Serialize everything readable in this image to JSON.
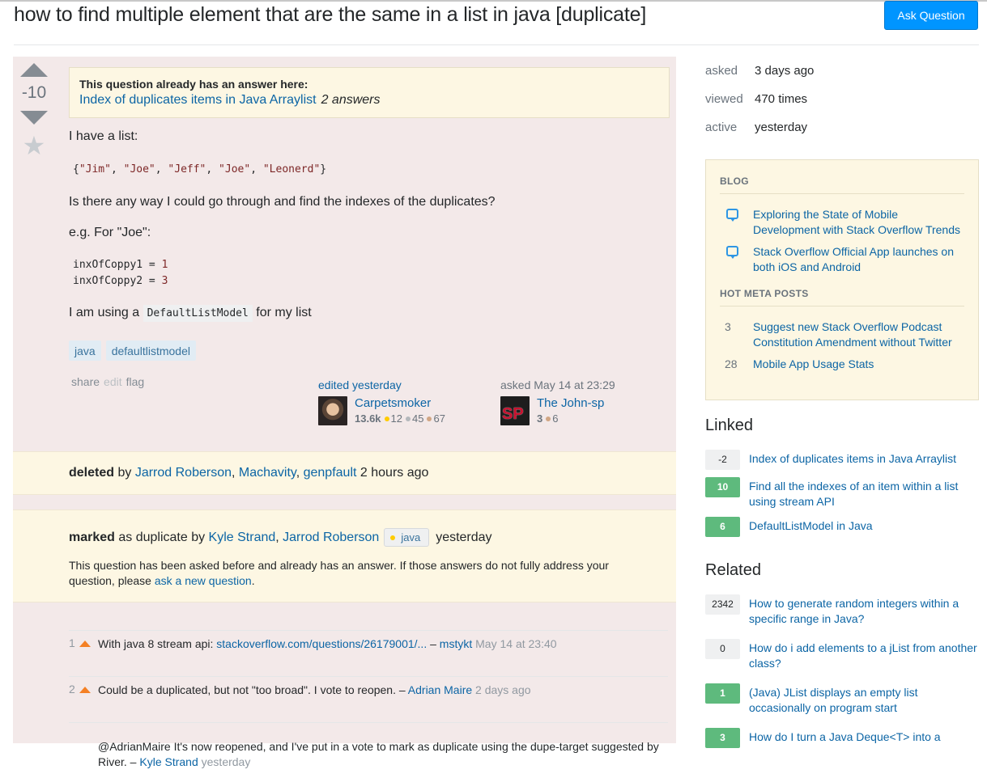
{
  "header": {
    "title": "how to find multiple element that are the same in a list in java [duplicate]",
    "ask_button": "Ask Question"
  },
  "question": {
    "vote_count": "-10",
    "duplicate_notice": {
      "lead": "This question already has an answer here:",
      "link": "Index of duplicates items in Java Arraylist",
      "answers": "2 answers"
    },
    "body": {
      "p1": "I have a list:",
      "code1": {
        "open": "{",
        "items": [
          "\"Jim\"",
          "\"Joe\"",
          "\"Jeff\"",
          "\"Joe\"",
          "\"Leonerd\""
        ],
        "close": "}"
      },
      "p2": "Is there any way I could go through and find the indexes of the duplicates?",
      "p3": "e.g. For \"Joe\":",
      "code2": [
        {
          "name": "inxOfCoppy1",
          "op": " = ",
          "value": "1"
        },
        {
          "name": "inxOfCoppy2",
          "op": " = ",
          "value": "3"
        }
      ],
      "p4_before": "I am using a ",
      "p4_code": "DefaultListModel",
      "p4_after": " for my list"
    },
    "tags": [
      "java",
      "defaultlistmodel"
    ],
    "menu": {
      "share": "share",
      "edit": "edit",
      "flag": "flag"
    },
    "editor": {
      "action": "edited yesterday",
      "name": "Carpetsmoker",
      "rep": "13.6k",
      "gold": "12",
      "silver": "45",
      "bronze": "67"
    },
    "owner": {
      "action": "asked May 14 at 23:29",
      "name": "The John-sp",
      "rep": "3",
      "bronze": "6"
    }
  },
  "deleted": {
    "label": "deleted",
    "by": " by ",
    "users": [
      "Jarrod Roberson",
      "Machavity",
      "genpfault"
    ],
    "time": " 2 hours ago"
  },
  "marked": {
    "label": "marked",
    "text": " as duplicate by ",
    "users": [
      "Kyle Strand",
      "Jarrod Roberson"
    ],
    "badge": "java",
    "time": "yesterday",
    "desc_before": "This question has been asked before and already has an answer. If those answers do not fully address your question, please ",
    "desc_link": "ask a new question",
    "desc_after": "."
  },
  "comments": [
    {
      "score": "1",
      "text": "With java 8 stream api: ",
      "link": "stackoverflow.com/questions/26179001/...",
      "user": "mstykt",
      "date": "May 14 at 23:40"
    },
    {
      "score": "2",
      "text": "Could be a duplicated, but not \"too broad\". I vote to reopen.",
      "user": "Adrian Maire",
      "date": "2 days ago"
    },
    {
      "score": "",
      "text": "@AdrianMaire It's now reopened, and I've put in a vote to mark as duplicate using the dupe-target suggested by River.",
      "user": "Kyle Strand",
      "date": "yesterday"
    }
  ],
  "sidebar": {
    "stats": [
      {
        "label": "asked",
        "value": "3 days ago"
      },
      {
        "label": "viewed",
        "value": "470 times"
      },
      {
        "label": "active",
        "value": "yesterday"
      }
    ],
    "blog": {
      "heading": "BLOG",
      "items": [
        "Exploring the State of Mobile Development with Stack Overflow Trends",
        "Stack Overflow Official App launches on both iOS and Android"
      ]
    },
    "hot_meta": {
      "heading": "HOT META POSTS",
      "items": [
        {
          "count": "3",
          "title": "Suggest new Stack Overflow Podcast Constitution Amendment without Twitter"
        },
        {
          "count": "28",
          "title": "Mobile App Usage Stats"
        }
      ]
    },
    "linked": {
      "heading": "Linked",
      "items": [
        {
          "score": "-2",
          "answered": false,
          "title": "Index of duplicates items in Java Arraylist"
        },
        {
          "score": "10",
          "answered": true,
          "title": "Find all the indexes of an item within a list using stream API"
        },
        {
          "score": "6",
          "answered": true,
          "title": "DefaultListModel in Java"
        }
      ]
    },
    "related": {
      "heading": "Related",
      "items": [
        {
          "score": "2342",
          "answered": false,
          "title": "How to generate random integers within a specific range in Java?"
        },
        {
          "score": "0",
          "answered": false,
          "title": "How do i add elements to a jList from another class?"
        },
        {
          "score": "1",
          "answered": true,
          "title": "(Java) JList displays an empty list occasionally on program start"
        },
        {
          "score": "3",
          "answered": true,
          "title": "How do I turn a Java Deque<T> into a"
        }
      ]
    }
  }
}
